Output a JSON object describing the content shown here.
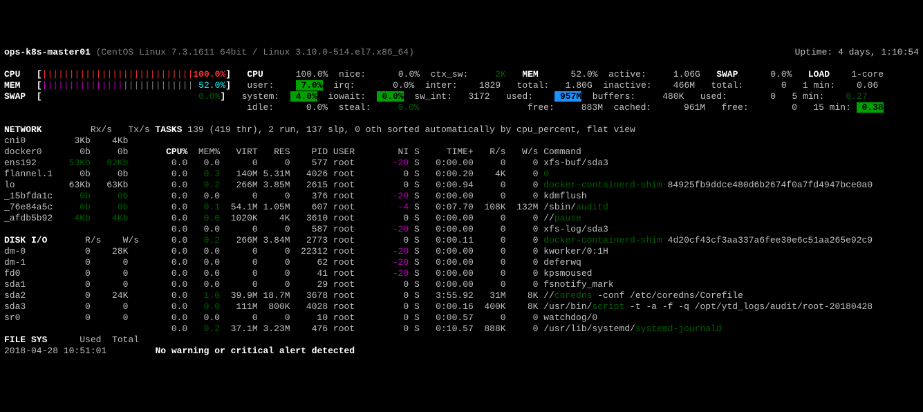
{
  "header": {
    "host": "ops-k8s-master01",
    "os": " (CentOS Linux 7.3.1611 64bit / Linux 3.10.0-514.el7.x86_64)",
    "uptime": "Uptime: 4 days, 1:10:54"
  },
  "summary": {
    "cpu_label": "CPU",
    "cpu_bar_val": "100.0%",
    "mem_label": "MEM",
    "mem_bar_val": " 52.0%",
    "swap_label": "SWAP",
    "swap_bar_val": " 0.0%",
    "cpu_hdr": "CPU",
    "cpu_pct": "100.0%",
    "user_lbl": "user:",
    "user_val": " 7.0%",
    "system_lbl": "system:",
    "system_val": " 4.0%",
    "idle_lbl": "idle:",
    "idle_val": "0.0%",
    "nice_lbl": "nice:",
    "nice_val": "0.0%",
    "irq_lbl": "irq:",
    "irq_val": "0.0%",
    "iowait_lbl": "iowait:",
    "iowait_val": " 0.0%",
    "steal_lbl": "steal:",
    "steal_val": "0.0%",
    "ctx_lbl": "ctx_sw:",
    "ctx_val": "   2K",
    "inter_lbl": "inter:",
    "inter_val": " 1829",
    "swint_lbl": "sw_int:",
    "swint_val": " 3172",
    "mem_hdr": "MEM",
    "mem_pct": "52.0%",
    "total_lbl": "total:",
    "total_val": "1.80G",
    "used_lbl": "used:",
    "used_val": " 957M",
    "free_lbl": "free:",
    "free_val": " 883M",
    "active_lbl": "active:",
    "active_val": "1.06G",
    "inactive_lbl": "inactive:",
    "inactive_val": " 466M",
    "buffers_lbl": "buffers:",
    "buffers_val": " 480K",
    "cached_lbl": "cached:",
    "cached_val": " 961M",
    "swap_hdr": "SWAP",
    "swap_pct": " 0.0%",
    "stotal_lbl": "total:",
    "stotal_val": "    0",
    "sused_lbl": "used:",
    "sused_val": "    0",
    "sfree_lbl": "free:",
    "sfree_val": "    0",
    "load_hdr": "LOAD",
    "load_core": "1-core",
    "l1_lbl": "1 min:",
    "l1_val": " 0.06",
    "l5_lbl": "5 min:",
    "l5_val": " 0.27",
    "l15_lbl": "15 min:",
    "l15_val": " 0.38"
  },
  "net": {
    "hdr": "NETWORK",
    "cols": "     Rx/s   Tx/s",
    "rows": [
      {
        "n": "cni0      ",
        "rx": "  3Kb",
        "tx": "  4Kb",
        "cls": ""
      },
      {
        "n": "docker0   ",
        "rx": "   0b",
        "tx": "   0b",
        "cls": ""
      },
      {
        "n": "ens192    ",
        "rx": " 53Kb",
        "tx": " 82Kb",
        "cls": "dim-green"
      },
      {
        "n": "flannel.1 ",
        "rx": "   0b",
        "tx": "   0b",
        "cls": ""
      },
      {
        "n": "lo        ",
        "rx": " 63Kb",
        "tx": " 63Kb",
        "cls": ""
      },
      {
        "n": "_15bfda1c ",
        "rx": "   0b",
        "tx": "   0b",
        "cls": "dim-green"
      },
      {
        "n": "_76e84a5c ",
        "rx": "   0b",
        "tx": "   0b",
        "cls": "dim-green"
      },
      {
        "n": "_afdb5b92 ",
        "rx": "  4Kb",
        "tx": "  4Kb",
        "cls": "dim-green"
      }
    ]
  },
  "disk": {
    "hdr": "DISK I/O",
    "cols": "    R/s    W/s",
    "rows": [
      {
        "n": "dm-0      ",
        "r": "    0",
        "w": "  28K"
      },
      {
        "n": "dm-1      ",
        "r": "    0",
        "w": "    0"
      },
      {
        "n": "fd0       ",
        "r": "    0",
        "w": "    0"
      },
      {
        "n": "sda1      ",
        "r": "    0",
        "w": "    0"
      },
      {
        "n": "sda2      ",
        "r": "    0",
        "w": "  24K"
      },
      {
        "n": "sda3      ",
        "r": "    0",
        "w": "    0"
      },
      {
        "n": "sr0       ",
        "r": "    0",
        "w": "    0"
      }
    ]
  },
  "tasks": {
    "hdr": "TASKS",
    "summary": " 139 (419 thr), 2 run, 137 slp, 0 oth sorted automatically by cpu_percent, flat view",
    "cols": {
      "cpu": "CPU%",
      "mem": " MEM%",
      "virt": "  VIRT",
      "res": "   RES",
      "pid": "   PID",
      "user": " USER",
      "ni": "NI",
      "s": "S",
      "time": "    TIME+",
      "rs": "  R/s",
      "ws": "  W/s",
      "cmd": " Command"
    }
  },
  "procs": [
    {
      "cpu": " 0.0",
      "mem": " 0.0",
      "memc": "",
      "virt": "     0",
      "res": "    0",
      "pid": "   577",
      "user": " root",
      "ni": "-20",
      "nic": "magenta",
      "s": "S",
      "time": " 0:00.00",
      "rs": "    0",
      "ws": "    0",
      "cmd": " xfs-buf/sda3"
    },
    {
      "cpu": " 0.0",
      "mem": " 0.3",
      "memc": "dim-green",
      "virt": "  140M",
      "res": "5.31M",
      "pid": "  4026",
      "user": " root",
      "ni": "  0",
      "nic": "",
      "s": "S",
      "time": " 0:00.20",
      "rs": "   4K",
      "ws": "    0",
      "cmd": " ",
      "g": "0"
    },
    {
      "cpu": " 0.0",
      "mem": " 0.2",
      "memc": "dim-green",
      "virt": "  266M",
      "res": "3.85M",
      "pid": "  2615",
      "user": " root",
      "ni": "  0",
      "nic": "",
      "s": "S",
      "time": " 0:00.94",
      "rs": "    0",
      "ws": "    0",
      "cmd": " ",
      "g": "docker-containerd-shim",
      "tail": " 84925fb9ddce480d6b2674f0a7fd4947bce0a0"
    },
    {
      "cpu": " 0.0",
      "mem": " 0.0",
      "memc": "",
      "virt": "     0",
      "res": "    0",
      "pid": "   376",
      "user": " root",
      "ni": "-20",
      "nic": "magenta",
      "s": "S",
      "time": " 0:00.00",
      "rs": "    0",
      "ws": "    0",
      "cmd": " kdmflush"
    },
    {
      "cpu": " 0.0",
      "mem": " 0.1",
      "memc": "dim-green",
      "virt": " 54.1M",
      "res": "1.05M",
      "pid": "   607",
      "user": " root",
      "ni": " -4",
      "nic": "magenta",
      "s": "S",
      "time": " 0:07.70",
      "rs": " 108K",
      "ws": " 132M",
      "cmd": " /sbin/",
      "g": "auditd"
    },
    {
      "cpu": " 0.0",
      "mem": " 0.0",
      "memc": "dim-green",
      "virt": " 1020K",
      "res": "   4K",
      "pid": "  3610",
      "user": " root",
      "ni": "  0",
      "nic": "",
      "s": "S",
      "time": " 0:00.00",
      "rs": "    0",
      "ws": "    0",
      "cmd": " //",
      "g": "pause"
    },
    {
      "cpu": " 0.0",
      "mem": " 0.0",
      "memc": "",
      "virt": "     0",
      "res": "    0",
      "pid": "   587",
      "user": " root",
      "ni": "-20",
      "nic": "magenta",
      "s": "S",
      "time": " 0:00.00",
      "rs": "    0",
      "ws": "    0",
      "cmd": " xfs-log/sda3"
    },
    {
      "cpu": " 0.0",
      "mem": " 0.2",
      "memc": "dim-green",
      "virt": "  266M",
      "res": "3.84M",
      "pid": "  2773",
      "user": " root",
      "ni": "  0",
      "nic": "",
      "s": "S",
      "time": " 0:00.11",
      "rs": "    0",
      "ws": "    0",
      "cmd": " ",
      "g": "docker-containerd-shim",
      "tail": " 4d20cf43cf3aa337a6fee30e6c51aa265e92c9"
    },
    {
      "cpu": " 0.0",
      "mem": " 0.0",
      "memc": "",
      "virt": "     0",
      "res": "    0",
      "pid": " 22312",
      "user": " root",
      "ni": "-20",
      "nic": "magenta",
      "s": "S",
      "time": " 0:00.00",
      "rs": "    0",
      "ws": "    0",
      "cmd": " kworker/0:1H"
    },
    {
      "cpu": " 0.0",
      "mem": " 0.0",
      "memc": "",
      "virt": "     0",
      "res": "    0",
      "pid": "    62",
      "user": " root",
      "ni": "-20",
      "nic": "magenta",
      "s": "S",
      "time": " 0:00.00",
      "rs": "    0",
      "ws": "    0",
      "cmd": " deferwq"
    },
    {
      "cpu": " 0.0",
      "mem": " 0.0",
      "memc": "",
      "virt": "     0",
      "res": "    0",
      "pid": "    41",
      "user": " root",
      "ni": "-20",
      "nic": "magenta",
      "s": "S",
      "time": " 0:00.00",
      "rs": "    0",
      "ws": "    0",
      "cmd": " kpsmoused"
    },
    {
      "cpu": " 0.0",
      "mem": " 0.0",
      "memc": "",
      "virt": "     0",
      "res": "    0",
      "pid": "    29",
      "user": " root",
      "ni": "  0",
      "nic": "",
      "s": "S",
      "time": " 0:00.00",
      "rs": "    0",
      "ws": "    0",
      "cmd": " fsnotify_mark"
    },
    {
      "cpu": " 0.0",
      "mem": " 1.0",
      "memc": "dim-green",
      "virt": " 39.9M",
      "res": "18.7M",
      "pid": "  3678",
      "user": " root",
      "ni": "  0",
      "nic": "",
      "s": "S",
      "time": " 3:55.92",
      "rs": "  31M",
      "ws": "   8K",
      "cmd": " //",
      "g": "coredns",
      "tail": " -conf /etc/coredns/Corefile"
    },
    {
      "cpu": " 0.0",
      "mem": " 0.0",
      "memc": "dim-green",
      "virt": "  111M",
      "res": " 800K",
      "pid": "  4028",
      "user": " root",
      "ni": "  0",
      "nic": "",
      "s": "S",
      "time": " 0:00.16",
      "rs": " 400K",
      "ws": "   8K",
      "cmd": " /usr/bin/",
      "g": "script",
      "tail": " -t -a -f -q /opt/ytd_logs/audit/root-20180428"
    },
    {
      "cpu": " 0.0",
      "mem": " 0.0",
      "memc": "",
      "virt": "     0",
      "res": "    0",
      "pid": "    10",
      "user": " root",
      "ni": "  0",
      "nic": "",
      "s": "S",
      "time": " 0:00.57",
      "rs": "    0",
      "ws": "    0",
      "cmd": " watchdog/0"
    },
    {
      "cpu": " 0.0",
      "mem": " 0.2",
      "memc": "dim-green",
      "virt": " 37.1M",
      "res": "3.23M",
      "pid": "   476",
      "user": " root",
      "ni": "  0",
      "nic": "",
      "s": "S",
      "time": " 0:10.57",
      "rs": " 888K",
      "ws": "    0",
      "cmd": " /usr/lib/systemd/",
      "g": "systemd-journald"
    }
  ],
  "fs": {
    "hdr": "FILE SYS",
    "cols": "   Used  Total",
    "ts": "2018-04-28 10:51:01"
  },
  "alert": "No warning or critical alert detected"
}
